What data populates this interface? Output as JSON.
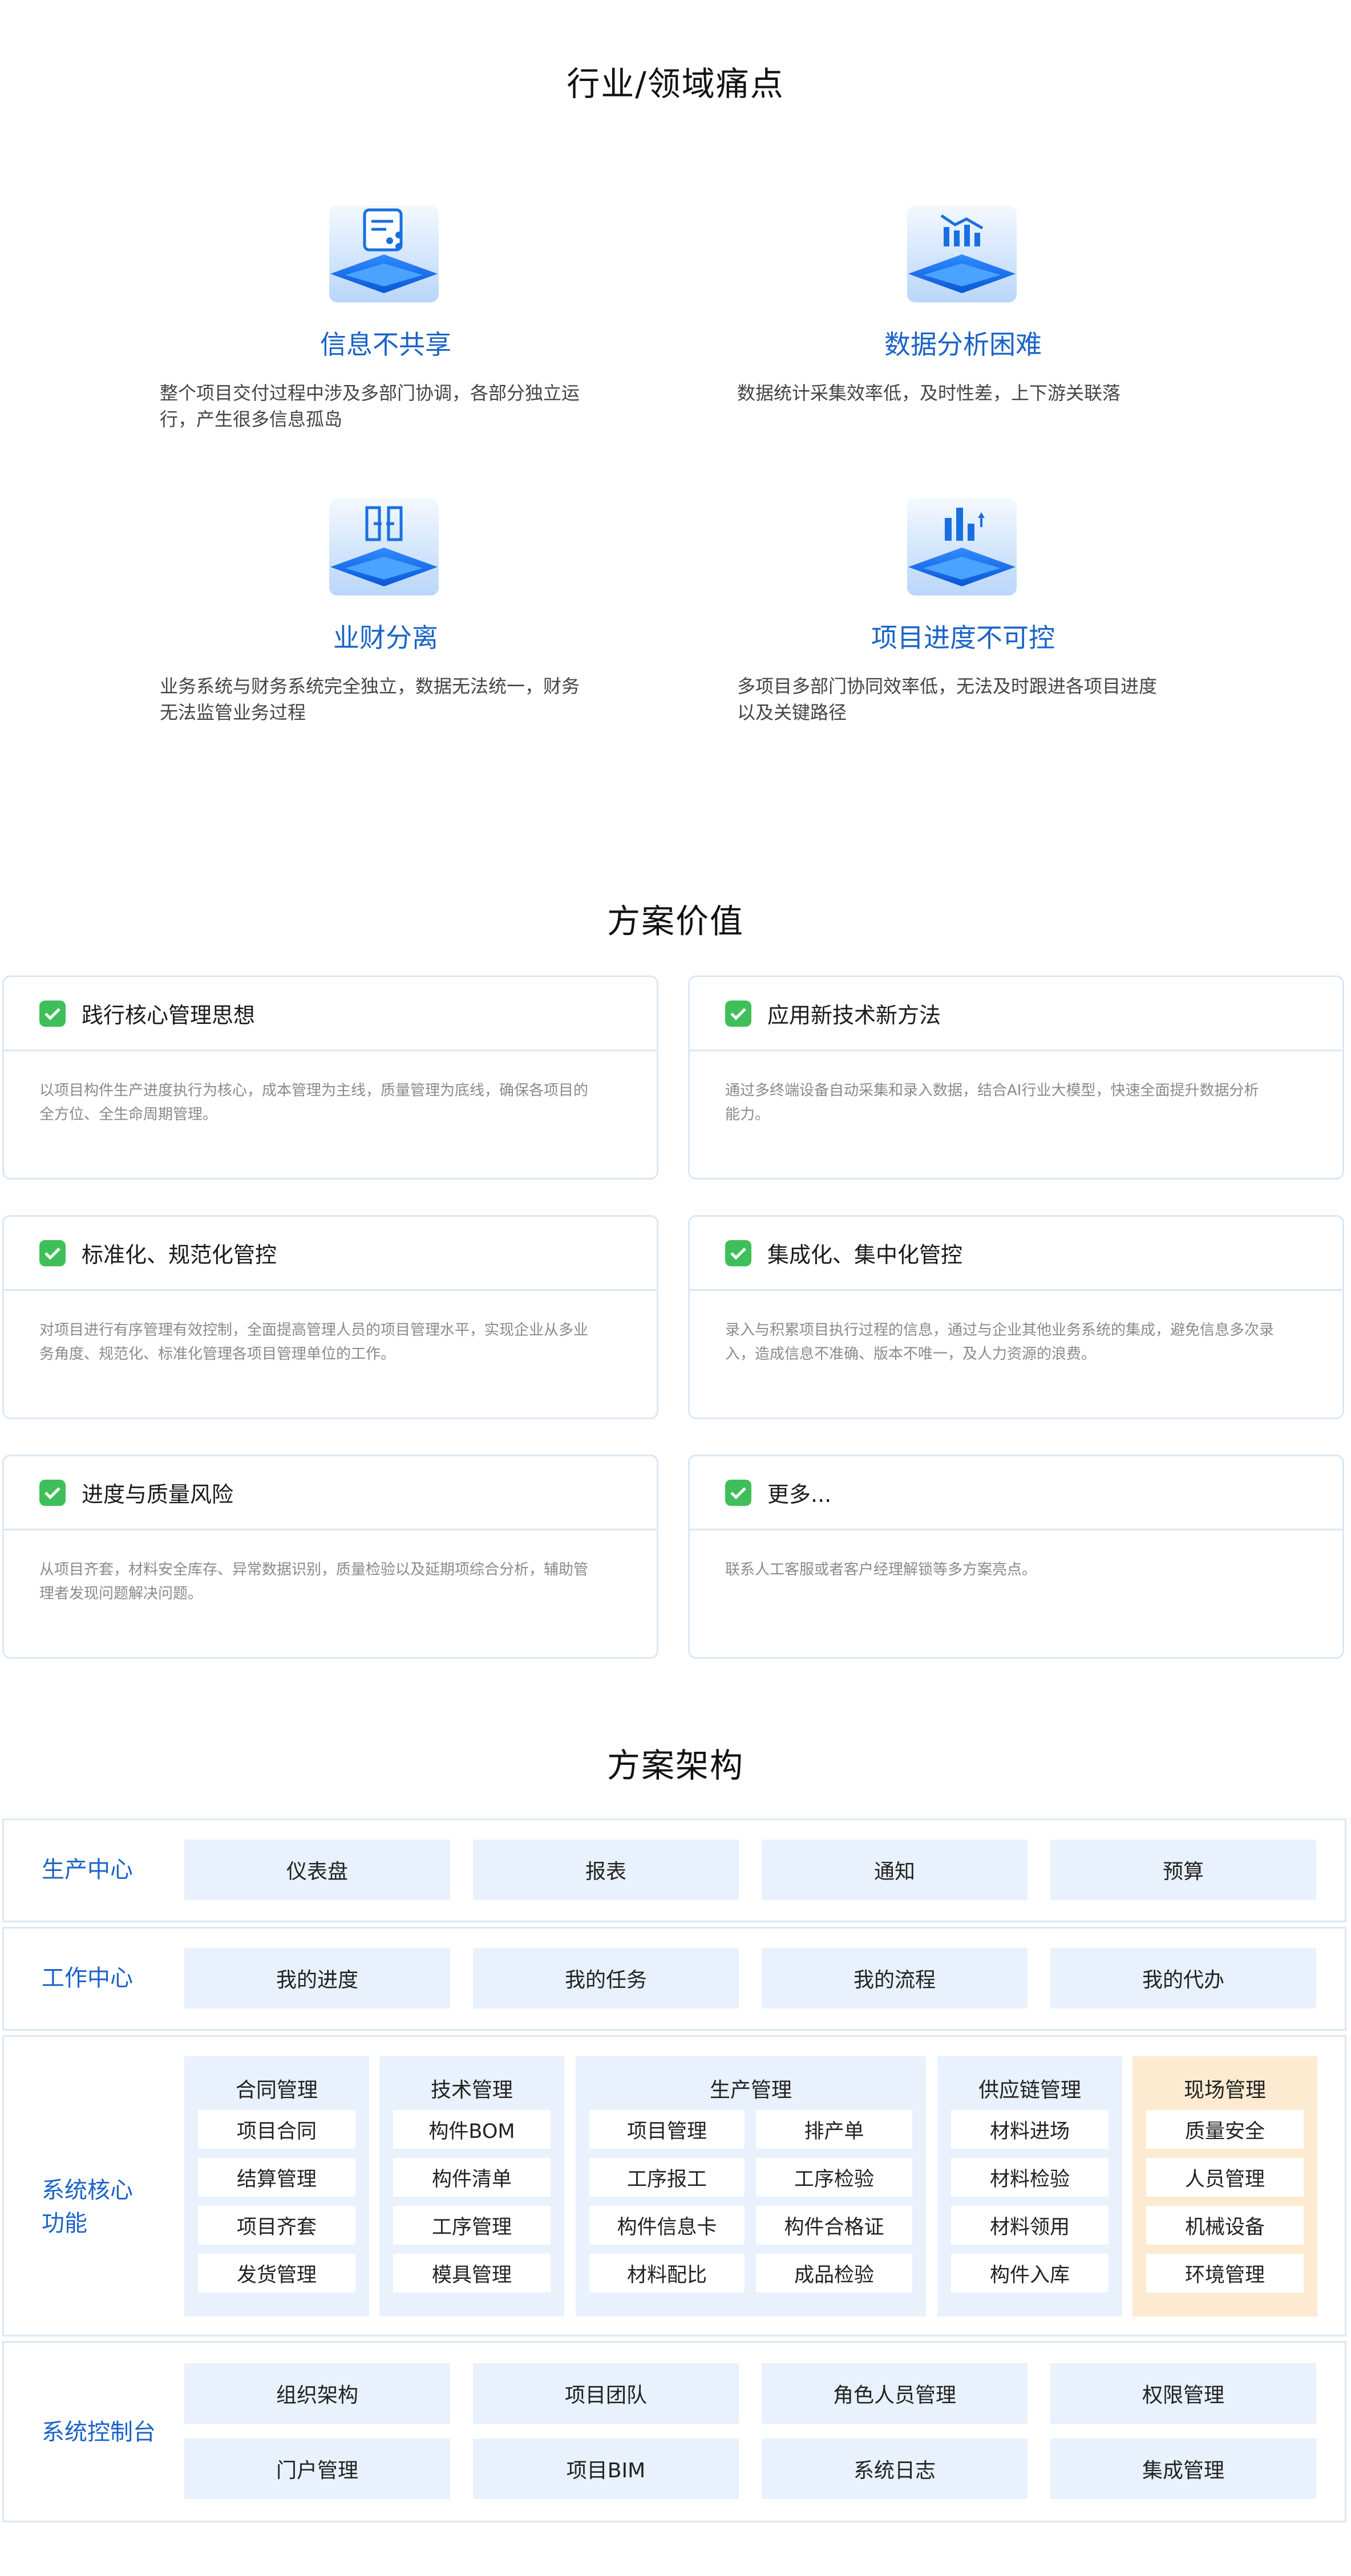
{
  "pain_section": {
    "title": "行业/领域痛点",
    "items": [
      {
        "icon": "document-share-icon",
        "title": "信息不共享",
        "desc_lines": [
          "整个项目交付过程中涉及多部门协调，各部分独立运",
          "行，产生很多信息孤岛"
        ]
      },
      {
        "icon": "data-chart-icon",
        "title": "数据分析困难",
        "desc_lines": [
          "数据统计采集效率低，及时性差，上下游关联落",
          ""
        ]
      },
      {
        "icon": "separation-icon",
        "title": "业财分离",
        "desc_lines": [
          "业务系统与财务系统完全独立，数据无法统一，财务",
          "无法监管业务过程"
        ]
      },
      {
        "icon": "progress-chart-icon",
        "title": "项目进度不可控",
        "desc_lines": [
          "多项目多部门协同效率低，无法及时跟进各项目进度",
          "以及关键路径"
        ]
      }
    ]
  },
  "value_section": {
    "title": "方案价值",
    "cards": [
      {
        "title": "践行核心管理思想",
        "desc_lines": [
          "以项目构件生产进度执行为核心，成本管理为主线，质量管理为底线，确保各项目的",
          "全方位、全生命周期管理。"
        ]
      },
      {
        "title": "应用新技术新方法",
        "desc_lines": [
          "通过多终端设备自动采集和录入数据，结合AI行业大模型，快速全面提升数据分析",
          "能力。"
        ]
      },
      {
        "title": "标准化、规范化管控",
        "desc_lines": [
          "对项目进行有序管理有效控制，全面提高管理人员的项目管理水平，实现企业从多业",
          "务角度、规范化、标准化管理各项目管理单位的工作。"
        ]
      },
      {
        "title": "集成化、集中化管控",
        "desc_lines": [
          "录入与积累项目执行过程的信息，通过与企业其他业务系统的集成，避免信息多次录",
          "入，造成信息不准确、版本不唯一，及人力资源的浪费。"
        ]
      },
      {
        "title": "进度与质量风险",
        "desc_lines": [
          "从项目齐套，材料安全库存、异常数据识别，质量检验以及延期项综合分析，辅助管",
          "理者发现问题解决问题。"
        ]
      },
      {
        "title": "更多...",
        "desc_lines": [
          "联系人工客服或者客户经理解锁等多方案亮点。",
          ""
        ]
      }
    ]
  },
  "arch_section": {
    "title": "方案架构",
    "production_center": {
      "label": "生产中心",
      "items": [
        "仪表盘",
        "报表",
        "通知",
        "预算"
      ]
    },
    "work_center": {
      "label": "工作中心",
      "items": [
        "我的进度",
        "我的任务",
        "我的流程",
        "我的代办"
      ]
    },
    "core_functions": {
      "label_lines": [
        "系统核心",
        "功能"
      ],
      "modules": [
        {
          "title": "合同管理",
          "items": [
            "项目合同",
            "结算管理",
            "项目齐套",
            "发货管理"
          ]
        },
        {
          "title": "技术管理",
          "items": [
            "构件BOM",
            "构件清单",
            "工序管理",
            "模具管理"
          ]
        },
        {
          "title": "生产管理",
          "items": [
            "项目管理",
            "排产单",
            "工序报工",
            "工序检验",
            "构件信息卡",
            "构件合格证",
            "材料配比",
            "成品检验"
          ]
        },
        {
          "title": "供应链管理",
          "items": [
            "材料进场",
            "材料检验",
            "材料领用",
            "构件入库"
          ]
        },
        {
          "title": "现场管理",
          "items": [
            "质量安全",
            "人员管理",
            "机械设备",
            "环境管理"
          ]
        }
      ]
    },
    "console": {
      "label": "系统控制台",
      "row1": [
        "组织架构",
        "项目团队",
        "角色人员管理",
        "权限管理"
      ],
      "row2": [
        "门户管理",
        "项目BIM",
        "系统日志",
        "集成管理"
      ]
    }
  }
}
